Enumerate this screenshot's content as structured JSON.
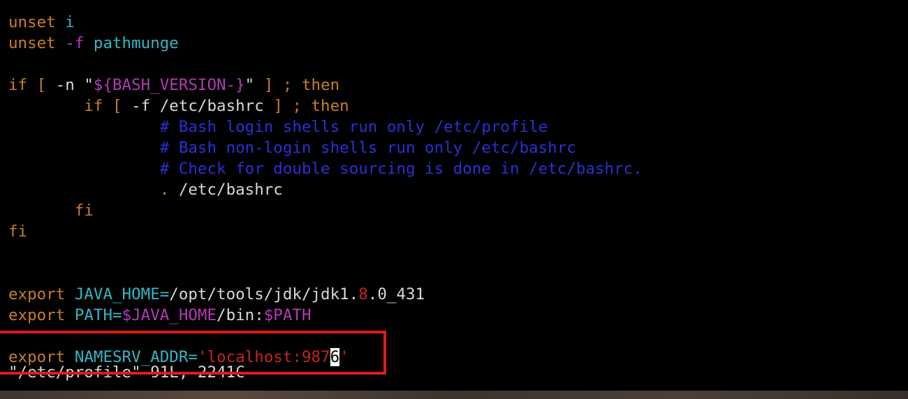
{
  "editor": {
    "lines": [
      {
        "indent": "",
        "segments": [
          {
            "t": "unset",
            "c": "orange"
          },
          {
            "t": " ",
            "c": "white"
          },
          {
            "t": "i",
            "c": "cyan"
          }
        ]
      },
      {
        "indent": "",
        "segments": [
          {
            "t": "unset",
            "c": "orange"
          },
          {
            "t": " ",
            "c": "white"
          },
          {
            "t": "-f",
            "c": "magenta"
          },
          {
            "t": " ",
            "c": "white"
          },
          {
            "t": "pathmunge",
            "c": "cyan"
          }
        ]
      },
      {
        "indent": "",
        "segments": []
      },
      {
        "indent": "",
        "segments": [
          {
            "t": "if",
            "c": "orange"
          },
          {
            "t": " ",
            "c": "white"
          },
          {
            "t": "[",
            "c": "orange"
          },
          {
            "t": " ",
            "c": "white"
          },
          {
            "t": "-n",
            "c": "white"
          },
          {
            "t": " ",
            "c": "white"
          },
          {
            "t": "\"",
            "c": "white"
          },
          {
            "t": "${BASH_VERSION-}",
            "c": "magenta"
          },
          {
            "t": "\"",
            "c": "white"
          },
          {
            "t": " ",
            "c": "white"
          },
          {
            "t": "]",
            "c": "orange"
          },
          {
            "t": " ",
            "c": "white"
          },
          {
            "t": ";",
            "c": "orange"
          },
          {
            "t": " ",
            "c": "white"
          },
          {
            "t": "then",
            "c": "orange"
          }
        ]
      },
      {
        "indent": "        ",
        "segments": [
          {
            "t": "if",
            "c": "orange"
          },
          {
            "t": " ",
            "c": "white"
          },
          {
            "t": "[",
            "c": "orange"
          },
          {
            "t": " ",
            "c": "white"
          },
          {
            "t": "-f",
            "c": "white"
          },
          {
            "t": " ",
            "c": "white"
          },
          {
            "t": "/etc/bashrc",
            "c": "white"
          },
          {
            "t": " ",
            "c": "white"
          },
          {
            "t": "]",
            "c": "orange"
          },
          {
            "t": " ",
            "c": "white"
          },
          {
            "t": ";",
            "c": "orange"
          },
          {
            "t": " ",
            "c": "white"
          },
          {
            "t": "then",
            "c": "orange"
          }
        ]
      },
      {
        "indent": "                ",
        "segments": [
          {
            "t": "# Bash login shells run only /etc/profile",
            "c": "blue"
          }
        ]
      },
      {
        "indent": "                ",
        "segments": [
          {
            "t": "# Bash non-login shells run only /etc/bashrc",
            "c": "blue"
          }
        ]
      },
      {
        "indent": "                ",
        "segments": [
          {
            "t": "# Check for double sourcing is done in /etc/bashrc.",
            "c": "blue"
          }
        ]
      },
      {
        "indent": "                ",
        "segments": [
          {
            "t": ".",
            "c": "orange"
          },
          {
            "t": " /etc/bashrc",
            "c": "white"
          }
        ]
      },
      {
        "indent": "       ",
        "segments": [
          {
            "t": "fi",
            "c": "orange"
          }
        ]
      },
      {
        "indent": "",
        "segments": [
          {
            "t": "fi",
            "c": "orange"
          }
        ]
      },
      {
        "indent": "",
        "segments": []
      },
      {
        "indent": "",
        "segments": []
      },
      {
        "indent": "",
        "segments": [
          {
            "t": "export",
            "c": "orange"
          },
          {
            "t": " ",
            "c": "white"
          },
          {
            "t": "JAVA_HOME",
            "c": "cyan"
          },
          {
            "t": "=",
            "c": "cyan"
          },
          {
            "t": "/opt/tools/jdk/jdk1.",
            "c": "white"
          },
          {
            "t": "8",
            "c": "red"
          },
          {
            "t": ".0_431",
            "c": "white"
          }
        ]
      },
      {
        "indent": "",
        "segments": [
          {
            "t": "export",
            "c": "orange"
          },
          {
            "t": " ",
            "c": "white"
          },
          {
            "t": "PATH",
            "c": "cyan"
          },
          {
            "t": "=",
            "c": "cyan"
          },
          {
            "t": "$JAVA_HOME",
            "c": "magenta"
          },
          {
            "t": "/bin:",
            "c": "white"
          },
          {
            "t": "$PATH",
            "c": "magenta"
          }
        ]
      },
      {
        "indent": "",
        "segments": []
      },
      {
        "indent": "",
        "segments": [
          {
            "t": "export",
            "c": "orange"
          },
          {
            "t": " ",
            "c": "white"
          },
          {
            "t": "NAMESRV_ADDR",
            "c": "cyan"
          },
          {
            "t": "=",
            "c": "cyan"
          },
          {
            "t": "'localhost:987",
            "c": "red"
          },
          {
            "t": "6",
            "c": "cursor"
          },
          {
            "t": "'",
            "c": "red"
          }
        ]
      }
    ],
    "status_line": "\"/etc/profile\" 91L, 2241C"
  },
  "colors": {
    "background": "#000000",
    "keyword": "#c87f22",
    "variable": "#35b6c4",
    "expansion": "#b43bb6",
    "comment": "#2d2fd6",
    "string": "#c42520",
    "plain": "#d8d8d8",
    "highlight_box": "#e11b1b"
  }
}
